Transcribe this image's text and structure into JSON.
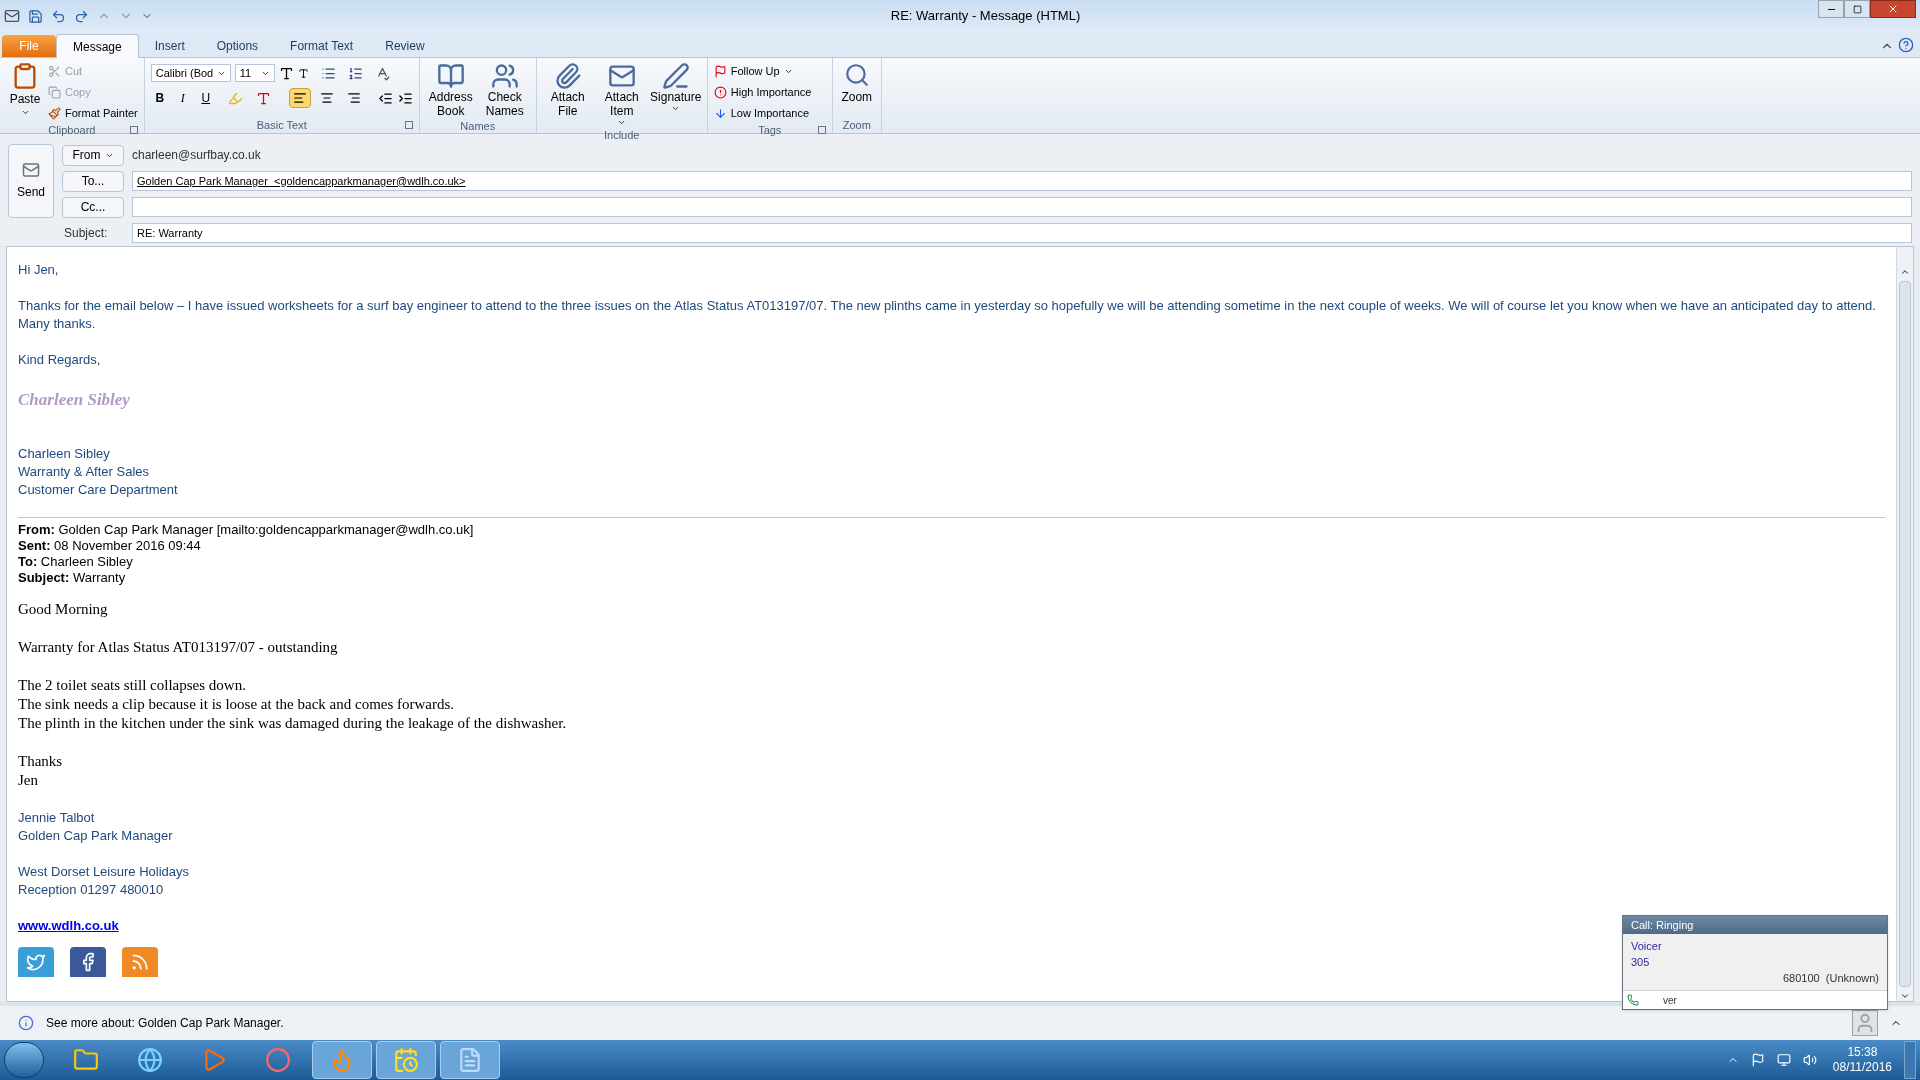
{
  "window": {
    "title": "RE: Warranty  -  Message (HTML)"
  },
  "file_tab": {
    "label": "File"
  },
  "tabs": [
    {
      "label": "Message",
      "selected": true
    },
    {
      "label": "Insert",
      "selected": false
    },
    {
      "label": "Options",
      "selected": false
    },
    {
      "label": "Format Text",
      "selected": false
    },
    {
      "label": "Review",
      "selected": false
    }
  ],
  "clipboard": {
    "label": "Clipboard",
    "paste": "Paste",
    "actions": [
      {
        "kind": "cut",
        "label": "Cut",
        "disabled": true
      },
      {
        "kind": "copy",
        "label": "Copy",
        "disabled": true
      },
      {
        "kind": "painter",
        "label": "Format Painter",
        "disabled": false
      }
    ]
  },
  "basic_text": {
    "label": "Basic Text",
    "font": "Calibri (Bod",
    "size": "11",
    "styles": [
      "B",
      "I",
      "U"
    ],
    "alignments": [
      {
        "kind": "left",
        "selected": true
      },
      {
        "kind": "center",
        "selected": false
      },
      {
        "kind": "right",
        "selected": false
      }
    ]
  },
  "large_groups": [
    {
      "label": "Names",
      "buttons": [
        {
          "kind": "book",
          "label": "Address Book",
          "menu": false
        },
        {
          "kind": "people",
          "label": "Check Names",
          "menu": false
        }
      ]
    },
    {
      "label": "Include",
      "buttons": [
        {
          "kind": "clip",
          "label": "Attach File",
          "menu": false
        },
        {
          "kind": "envelope",
          "label": "Attach Item",
          "menu": true
        },
        {
          "kind": "pen",
          "label": "Signature",
          "menu": true
        }
      ]
    }
  ],
  "tags": {
    "label": "Tags",
    "actions": [
      {
        "kind": "flag",
        "label": "Follow Up",
        "menu": true
      },
      {
        "kind": "high",
        "label": "High Importance",
        "menu": false
      },
      {
        "kind": "low",
        "label": "Low Importance",
        "menu": false
      }
    ]
  },
  "zoom": {
    "label": "Zoom",
    "button": "Zoom"
  },
  "header": {
    "send": "Send",
    "from_button": "From",
    "from": "charleen@surfbay.co.uk",
    "to_button": "To...",
    "to": "Golden Cap Park Manager  <goldencapparkmanager@wdlh.co.uk>",
    "cc_button": "Cc...",
    "subject_label": "Subject:",
    "subject": "RE: Warranty"
  },
  "body": [
    {
      "kind": "plain",
      "lines": [
        "Hi Jen,"
      ]
    },
    {
      "kind": "plain",
      "lines": [
        "Thanks for the email below – I have issued worksheets for a surf bay engineer to attend to the three issues on the Atlas Status AT013197/07.  The new plinths came in yesterday so hopefully we will be attending sometime in the next couple of weeks.  We will of course let you know when we have an anticipated day to attend.  Many thanks."
      ]
    },
    {
      "kind": "plain",
      "lines": [
        "Kind Regards,"
      ]
    },
    {
      "kind": "script",
      "lines": [
        "Charleen Sibley"
      ]
    },
    {
      "kind": "plain",
      "lines": [
        "Charleen Sibley",
        "Warranty & After Sales",
        "Customer Care Department"
      ]
    },
    {
      "kind": "quote_header",
      "lines": [
        "**From:** Golden Cap Park Manager [mailto:goldencapparkmanager@wdlh.co.uk]",
        "**Sent:** 08 November 2016 09:44",
        "**To:** Charleen Sibley",
        "**Subject:** Warranty"
      ]
    },
    {
      "kind": "serif",
      "lines": [
        "Good Morning"
      ]
    },
    {
      "kind": "serif",
      "lines": [
        "Warranty for Atlas Status AT013197/07 - outstanding"
      ]
    },
    {
      "kind": "serif",
      "lines": [
        "The 2 toilet seats still collapses down.",
        "The sink needs a clip because it is loose at the back and comes forwards.",
        "The plinth in the kitchen under the sink was damaged during the leakage of the dishwasher."
      ]
    },
    {
      "kind": "serif",
      "lines": [
        "Thanks",
        "Jen"
      ]
    },
    {
      "kind": "plain",
      "lines": [
        "Jennie Talbot",
        "Golden Cap Park Manager"
      ]
    },
    {
      "kind": "plain",
      "lines": [
        "West Dorset Leisure Holidays",
        "Reception 01297 480010"
      ]
    },
    {
      "kind": "link",
      "lines": [
        "www.wdlh.co.uk"
      ]
    },
    {
      "kind": "social"
    }
  ],
  "status_bar": {
    "text": "See more about: Golden Cap Park Manager."
  },
  "call_popup": {
    "title": "Call: Ringing",
    "caller": "Voicer",
    "extension": "305",
    "number": "680100  (Unknown)",
    "footer": "ver"
  },
  "taskbar": {
    "apps": [
      {
        "kind": "folder",
        "open": false
      },
      {
        "kind": "browser",
        "open": false
      },
      {
        "kind": "media",
        "open": false
      },
      {
        "kind": "chrome",
        "open": false
      },
      {
        "kind": "firefox",
        "open": true
      },
      {
        "kind": "outlook",
        "open": true
      },
      {
        "kind": "word",
        "open": true
      }
    ],
    "time": "15:38",
    "date": "08/11/2016"
  }
}
